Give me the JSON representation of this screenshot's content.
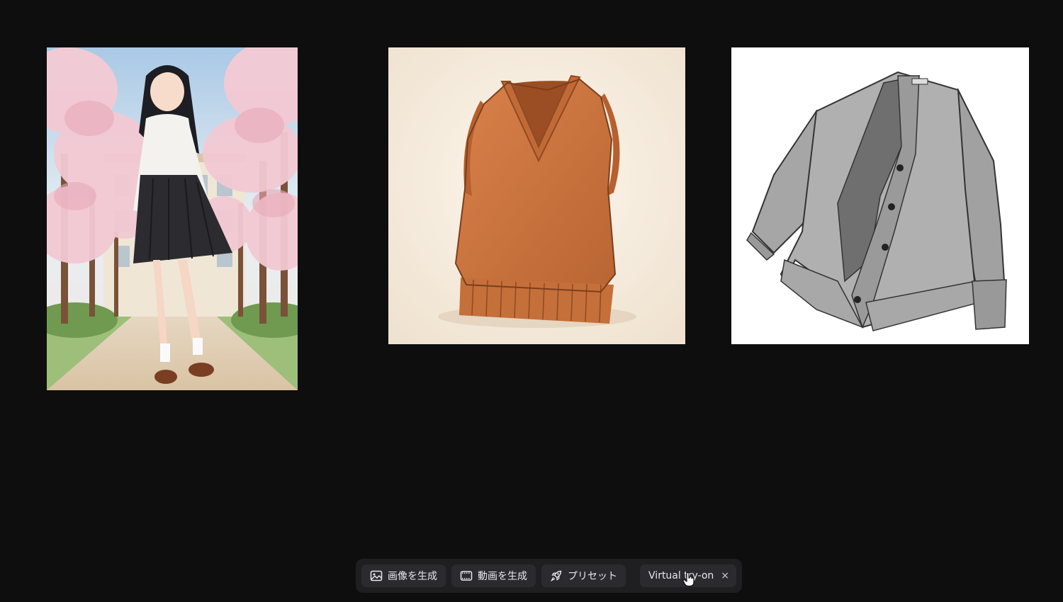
{
  "canvas": {
    "images": [
      {
        "name": "girl-school-uniform-image"
      },
      {
        "name": "orange-sweater-vest-image"
      },
      {
        "name": "gray-cardigan-image"
      }
    ]
  },
  "toolbar": {
    "generate_image_label": "画像を生成",
    "generate_video_label": "動画を生成",
    "preset_label": "プリセット",
    "virtual_tryon_label": "Virtual try-on",
    "close_glyph": "×"
  },
  "colors": {
    "background": "#0e0e0f",
    "toolbar_bg": "#1f1f22",
    "button_bg": "#2b2b2f",
    "text": "#e9e9ec"
  },
  "icons": {
    "generate_image": "image-icon",
    "generate_video": "film-icon",
    "preset": "rocket-icon",
    "close": "close-icon",
    "cursor": "hand-pointer-icon"
  }
}
